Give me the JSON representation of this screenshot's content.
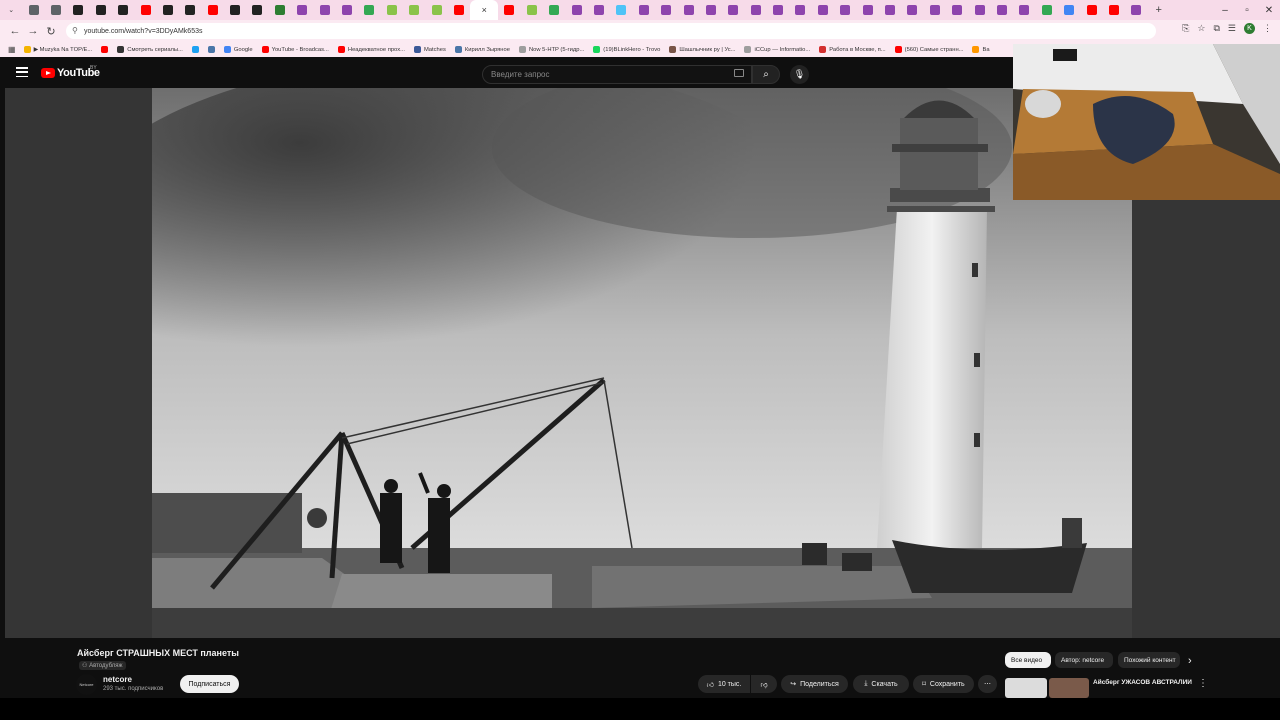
{
  "browser": {
    "tab_colors": [
      "#5f6368",
      "#5f6368",
      "#222222",
      "#222222",
      "#222222",
      "#ff0000",
      "#222222",
      "#222222",
      "#ff0000",
      "#222222",
      "#222222",
      "#2e7d32",
      "#8e44ad",
      "#8e44ad",
      "#8e44ad",
      "#34a853",
      "#8bc34a",
      "#8bc34a",
      "#8bc34a",
      "#ff0000",
      "#ff0000",
      "#8bc34a",
      "#34a853",
      "#8e44ad",
      "#8e44ad",
      "#4fc3f7",
      "#8e44ad",
      "#8e44ad",
      "#8e44ad",
      "#8e44ad",
      "#8e44ad",
      "#8e44ad",
      "#8e44ad",
      "#8e44ad",
      "#8e44ad",
      "#8e44ad",
      "#8e44ad",
      "#8e44ad",
      "#8e44ad",
      "#8e44ad",
      "#8e44ad",
      "#8e44ad",
      "#8e44ad",
      "#8e44ad",
      "#34a853",
      "#4285f4",
      "#ff0000",
      "#ff0000",
      "#8e44ad"
    ],
    "active_tab_close": "×",
    "new_tab": "+",
    "url": "youtube.com/watch?v=3DDyAMk653s",
    "profile_initial": "K",
    "bookmarks": [
      {
        "label": "▶ Muzyka Na TOP/E...",
        "color": "#f4b400"
      },
      {
        "label": "",
        "color": "#ff0000"
      },
      {
        "label": "Смотреть сериалы...",
        "color": "#333333"
      },
      {
        "label": "",
        "color": "#1da1f2"
      },
      {
        "label": "",
        "color": "#4a76a8"
      },
      {
        "label": "Google",
        "color": "#4285f4"
      },
      {
        "label": "YouTube - Broadcas...",
        "color": "#ff0000"
      },
      {
        "label": "Неадекватное прох...",
        "color": "#ff0000"
      },
      {
        "label": "Matches",
        "color": "#3b5998"
      },
      {
        "label": "Кирилл Зыряное",
        "color": "#4a76a8"
      },
      {
        "label": "Now 5-HTP (5-гидр...",
        "color": "#9e9e9e"
      },
      {
        "label": "(19)BLinkHero - Trovo",
        "color": "#19d65c"
      },
      {
        "label": "Шашлычник ру | Ус...",
        "color": "#795548"
      },
      {
        "label": "iCCup — Informatio...",
        "color": "#9e9e9e"
      },
      {
        "label": "Работа в Москве, п...",
        "color": "#d32f2f"
      },
      {
        "label": "(560) Самые странн...",
        "color": "#ff0000"
      },
      {
        "label": "Ва",
        "color": "#ff9800"
      }
    ]
  },
  "youtube": {
    "logo_text": "YouTube",
    "country_code": "BY",
    "search_placeholder": "Введите запрос",
    "video": {
      "title": "Айсберг СТРАШНЫХ МЕСТ планеты",
      "dub_badge": "Автодубляж",
      "channel": "netcore",
      "channel_avatar_text": "Netcore",
      "subscribers": "293 тыс. подписчиков",
      "subscribe_label": "Подписаться",
      "likes": "10 тыс.",
      "share_label": "Поделиться",
      "download_label": "Скачать",
      "save_label": "Сохранить",
      "more_label": "⋯"
    },
    "chips": [
      "Все видео",
      "Автор: netcore",
      "Похожий контент"
    ],
    "recommendation": {
      "title": "Айсберг УЖАСОВ АВСТРАЛИИ"
    }
  }
}
